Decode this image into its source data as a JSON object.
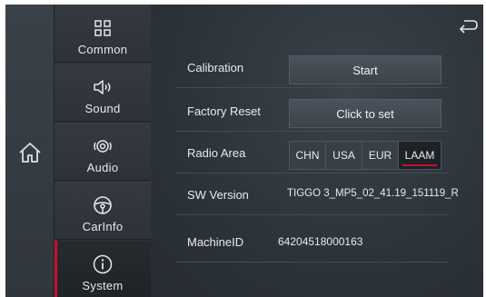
{
  "sidebar": {
    "items": [
      {
        "label": "Common",
        "icon": "grid-icon",
        "active": false
      },
      {
        "label": "Sound",
        "icon": "speaker-icon",
        "active": false
      },
      {
        "label": "Audio",
        "icon": "audio-icon",
        "active": false
      },
      {
        "label": "CarInfo",
        "icon": "steering-wheel-icon",
        "active": false
      },
      {
        "label": "System",
        "icon": "info-icon",
        "active": true
      }
    ]
  },
  "settings": {
    "calibration": {
      "label": "Calibration",
      "button": "Start"
    },
    "factory_reset": {
      "label": "Factory Reset",
      "button": "Click to set"
    },
    "radio_area": {
      "label": "Radio Area",
      "options": [
        "CHN",
        "USA",
        "EUR",
        "LAAM"
      ],
      "selected": "LAAM"
    },
    "sw_version": {
      "label": "SW Version",
      "value": "TIGGO 3_MP5_02_41.19_151119_R"
    },
    "machine_id": {
      "label": "MachineID",
      "value": "64204518000163"
    }
  },
  "colors": {
    "accent": "#c8102e",
    "background": "#2b3137"
  }
}
